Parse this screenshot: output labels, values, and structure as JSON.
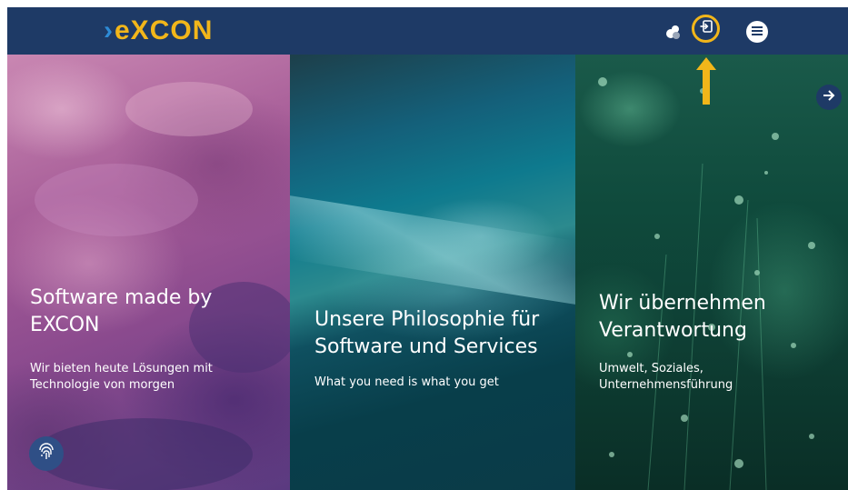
{
  "header": {
    "logo": {
      "chevron": "›",
      "word": "eXCON"
    },
    "icons": [
      "users-icon",
      "login-icon",
      "menu-icon"
    ],
    "colors": {
      "bar": "#1e3a66",
      "accent": "#f2b61a",
      "logo_chevron": "#2d8bd6"
    }
  },
  "panels": [
    {
      "title": "Software made by EXCON",
      "subtitle": "Wir bieten heute Lösungen mit Technologie von morgen"
    },
    {
      "title": "Unsere Philosophie für Software und Services",
      "subtitle": "What you need is what you get"
    },
    {
      "title": "Wir übernehmen Verantwortung",
      "subtitle": "Umwelt, Soziales, Unternehmensführung"
    }
  ],
  "controls": {
    "next_icon": "arrow-right-icon",
    "fingerprint_icon": "fingerprint-icon"
  },
  "annotation": {
    "arrow_color": "#f2b61a"
  }
}
